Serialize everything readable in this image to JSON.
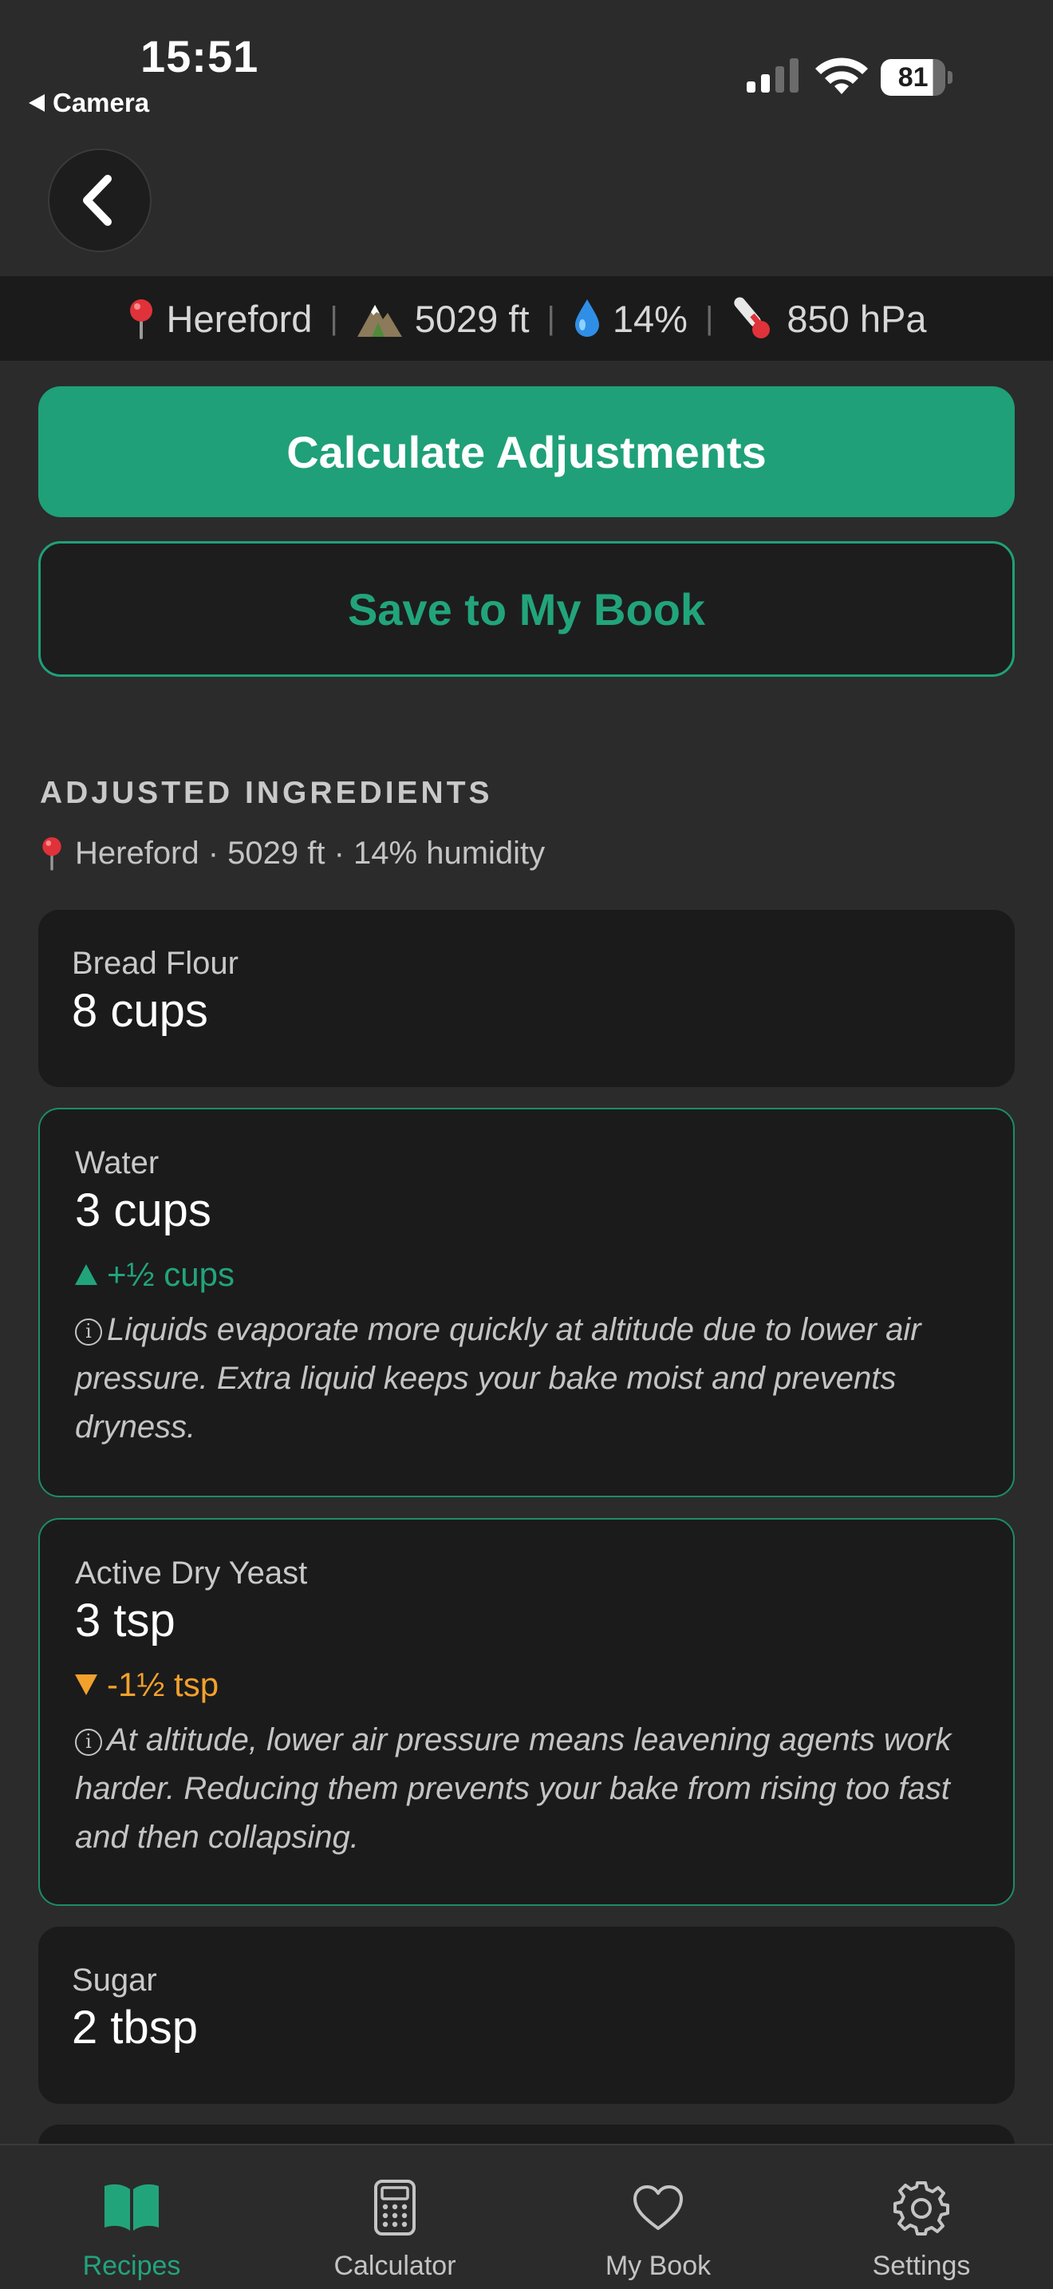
{
  "status_bar": {
    "time": "15:51",
    "back_app": "Camera",
    "battery": "81"
  },
  "location_strip": {
    "place": "Hereford",
    "elevation": "5029 ft",
    "humidity": "14%",
    "pressure": "850 hPa",
    "icons": [
      "pin-icon",
      "mountain-icon",
      "droplet-icon",
      "thermometer-icon"
    ]
  },
  "actions": {
    "calculate_label": "Calculate Adjustments",
    "save_label": "Save to My Book"
  },
  "section": {
    "title": "ADJUSTED INGREDIENTS",
    "subtitle": "Hereford · 5029 ft · 14% humidity"
  },
  "ingredients": [
    {
      "name": "Bread Flour",
      "quantity": "8 cups"
    },
    {
      "name": "Water",
      "quantity": "3 cups",
      "change": "+½ cups",
      "direction": "up",
      "note": "Liquids evaporate more quickly at altitude due to lower air pressure. Extra liquid keeps your bake moist and prevents dryness."
    },
    {
      "name": "Active Dry Yeast",
      "quantity": "3 tsp",
      "change": "-1½ tsp",
      "direction": "down",
      "note": "At altitude, lower air pressure means leavening agents work harder. Reducing them prevents your bake from rising too fast and then collapsing."
    },
    {
      "name": "Sugar",
      "quantity": "2 tbsp"
    }
  ],
  "tabs": [
    {
      "label": "Recipes",
      "icon": "book-icon",
      "active": true
    },
    {
      "label": "Calculator",
      "icon": "calculator-icon",
      "active": false
    },
    {
      "label": "My Book",
      "icon": "heart-icon",
      "active": false
    },
    {
      "label": "Settings",
      "icon": "gear-icon",
      "active": false
    }
  ],
  "colors": {
    "accent": "#1fa078",
    "increase": "#22a47b",
    "decrease": "#f2a12c",
    "background": "#2b2b2b",
    "card": "#1b1b1b"
  }
}
